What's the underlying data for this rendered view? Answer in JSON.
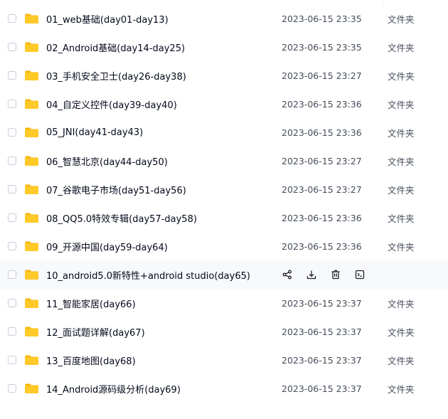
{
  "files": [
    {
      "name": "01_web基础(day01-day13)",
      "date": "2023-06-15 23:35",
      "type": "文件夹"
    },
    {
      "name": "02_Android基础(day14-day25)",
      "date": "2023-06-15 23:35",
      "type": "文件夹"
    },
    {
      "name": "03_手机安全卫士(day26-day38)",
      "date": "2023-06-15 23:27",
      "type": "文件夹"
    },
    {
      "name": "04_自定义控件(day39-day40)",
      "date": "2023-06-15 23:36",
      "type": "文件夹"
    },
    {
      "name": "05_JNI(day41-day43)",
      "date": "2023-06-15 23:36",
      "type": "文件夹"
    },
    {
      "name": "06_智慧北京(day44-day50)",
      "date": "2023-06-15 23:27",
      "type": "文件夹"
    },
    {
      "name": "07_谷歌电子市场(day51-day56)",
      "date": "2023-06-15 23:27",
      "type": "文件夹"
    },
    {
      "name": "08_QQ5.0特效专辑(day57-day58)",
      "date": "2023-06-15 23:36",
      "type": "文件夹"
    },
    {
      "name": "09_开源中国(day59-day64)",
      "date": "2023-06-15 23:36",
      "type": "文件夹"
    },
    {
      "name": "10_android5.0新特性+android studio(day65)",
      "date": "",
      "type": "",
      "hovered": true
    },
    {
      "name": "11_智能家居(day66)",
      "date": "2023-06-15 23:37",
      "type": "文件夹"
    },
    {
      "name": "12_面试题详解(day67)",
      "date": "2023-06-15 23:37",
      "type": "文件夹"
    },
    {
      "name": "13_百度地图(day68)",
      "date": "2023-06-15 23:37",
      "type": "文件夹"
    },
    {
      "name": "14_Android源码级分析(day69)",
      "date": "2023-06-15 23:37",
      "type": "文件夹"
    }
  ],
  "hover_actions": [
    "share-icon",
    "download-icon",
    "delete-icon",
    "more-icon"
  ],
  "colors": {
    "folder": "#ffc928",
    "folder_back": "#f5b400",
    "hover_row": "#f7f9fc",
    "text": "#03081a",
    "secondary_text": "#454d5a"
  }
}
